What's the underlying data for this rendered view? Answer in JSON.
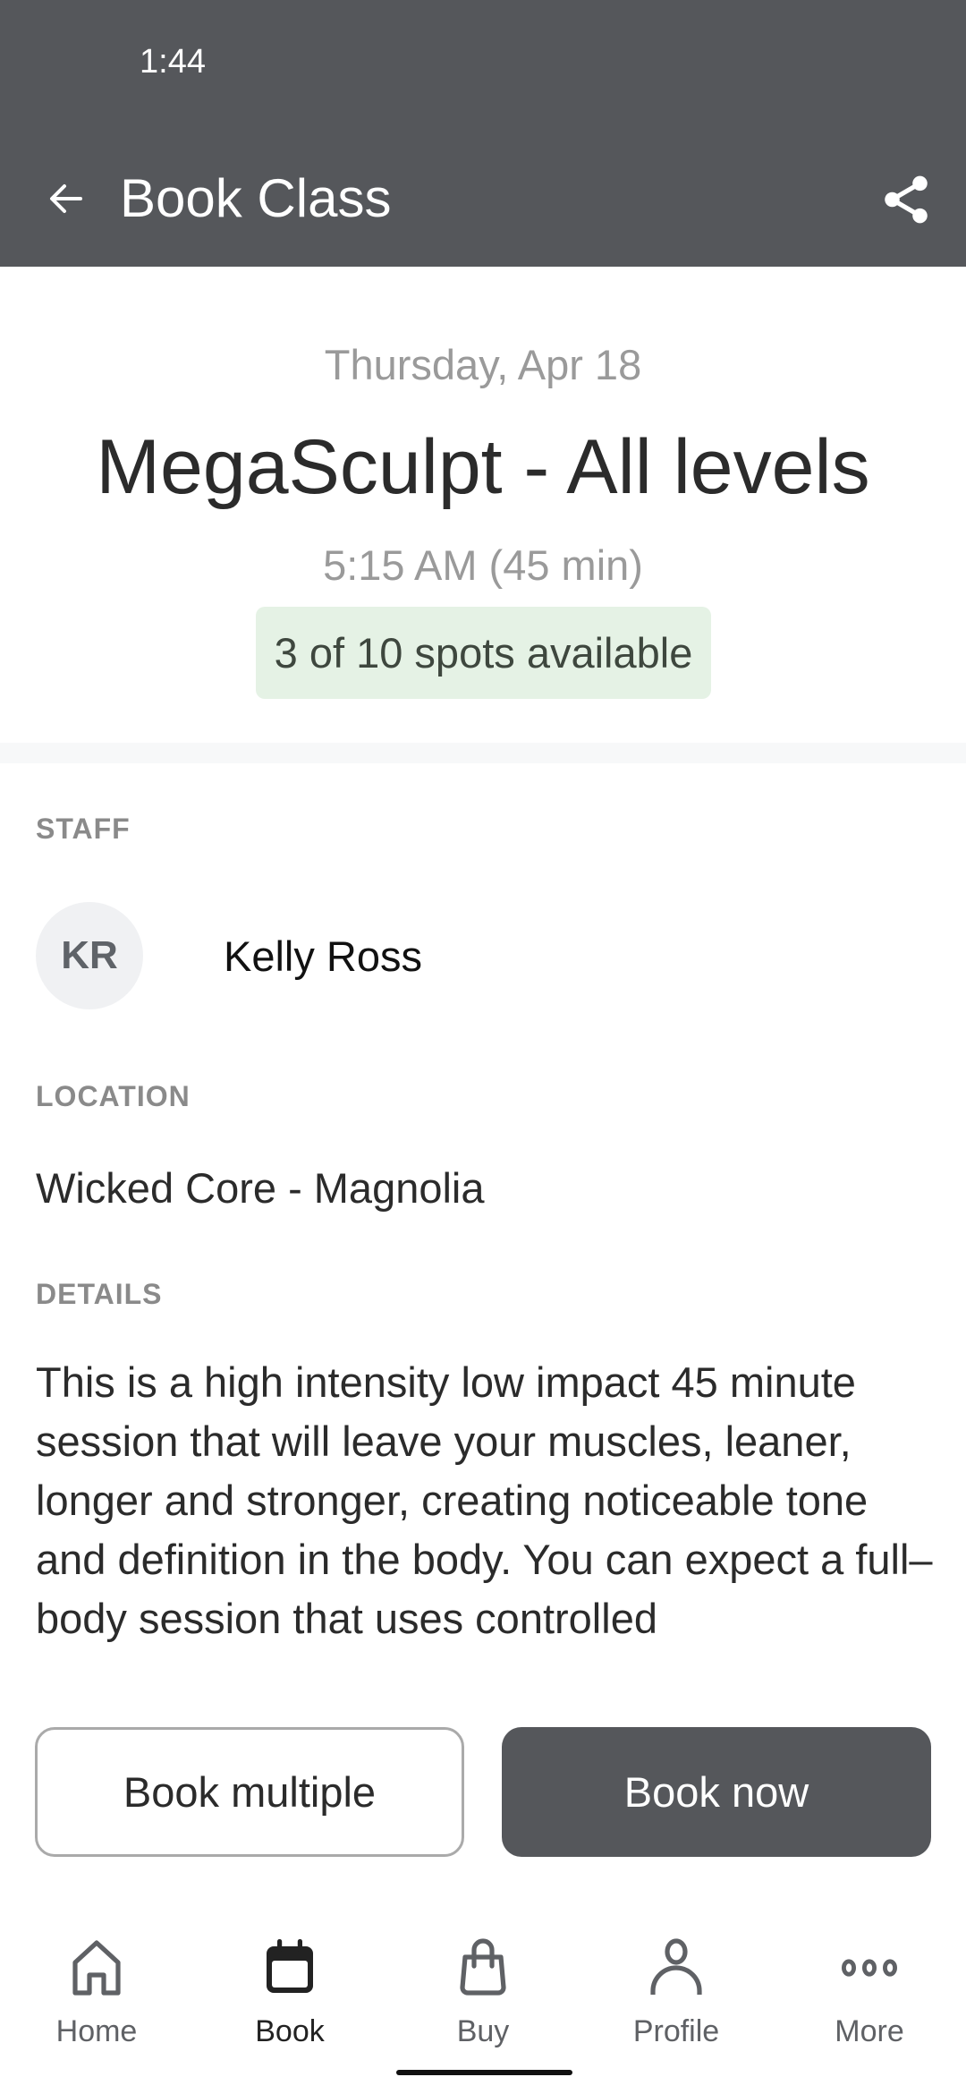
{
  "status_bar": {
    "time": "1:44"
  },
  "app_bar": {
    "title": "Book Class",
    "back_icon": "arrow-left-icon",
    "share_icon": "share-icon"
  },
  "class": {
    "date": "Thursday, Apr 18",
    "title": "MegaSculpt - All levels",
    "time": "5:15 AM (45 min)",
    "availability": "3 of 10 spots available",
    "spots_available": 3,
    "spots_total": 10
  },
  "staff": {
    "label": "STAFF",
    "initials": "KR",
    "name": "Kelly Ross"
  },
  "location": {
    "label": "LOCATION",
    "value": "Wicked Core - Magnolia"
  },
  "details": {
    "label": "DETAILS",
    "text": "This is a high intensity low impact 45 minute session that will leave your muscles, leaner, longer and stronger, creating noticeable tone and definition in the body. You can expect a full–body session that uses controlled"
  },
  "actions": {
    "book_multiple": "Book multiple",
    "book_now": "Book now"
  },
  "bottom_nav": {
    "items": [
      {
        "label": "Home",
        "icon": "home-icon",
        "active": false
      },
      {
        "label": "Book",
        "icon": "calendar-icon",
        "active": true
      },
      {
        "label": "Buy",
        "icon": "shopping-bag-icon",
        "active": false
      },
      {
        "label": "Profile",
        "icon": "person-icon",
        "active": false
      },
      {
        "label": "More",
        "icon": "more-dots-icon",
        "active": false
      }
    ]
  },
  "colors": {
    "app_bar": "#55575b",
    "primary_button": "#55575b",
    "availability_badge_bg": "#e5f2e5",
    "section_label": "#8a8a8a",
    "muted_text": "#9a9a9a"
  }
}
